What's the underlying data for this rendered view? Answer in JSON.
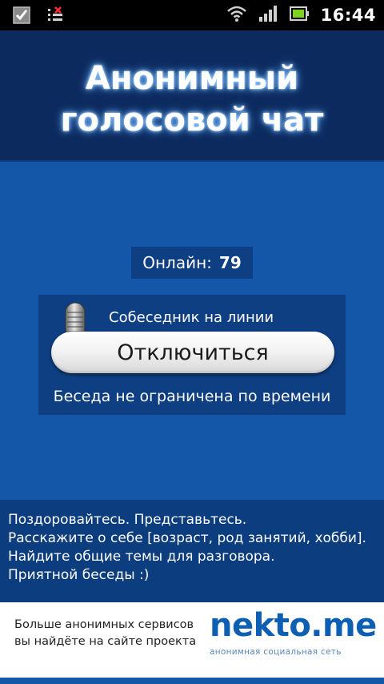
{
  "status_bar": {
    "time": "16:44",
    "icons": [
      "checkbox-notification-icon",
      "app-notification-icon",
      "wifi-icon",
      "signal-icon",
      "battery-icon"
    ]
  },
  "header": {
    "title_line1": "Анонимный",
    "title_line2": "голосовой чат"
  },
  "online": {
    "label": "Онлайн:",
    "value": "79"
  },
  "call": {
    "status": "Собеседник на линии",
    "disconnect_label": "Отключиться",
    "time_limit": "Беседа не ограничена по времени"
  },
  "tips": [
    "Поздоровайтесь. Представьтесь.",
    "Расскажите о себе [возраст, род занятий, хобби].",
    "Найдите общие темы для разговора.",
    "Приятной беседы :)"
  ],
  "ad": {
    "text_line1": "Больше анонимных сервисов",
    "text_line2": "вы найдёте на сайте проекта",
    "brand": "nekto.me",
    "tagline": "анонимная социальная сеть"
  },
  "colors": {
    "background": "#1456a8",
    "header_bg": "#0c2a5e",
    "panel_bg": "#0e3f83",
    "brand": "#0d5fb3"
  }
}
